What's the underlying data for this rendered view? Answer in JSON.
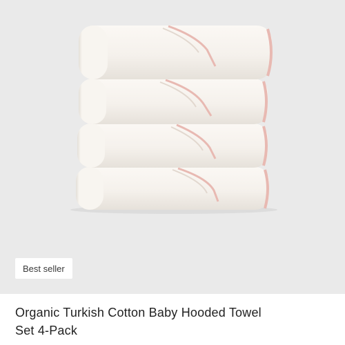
{
  "product": {
    "badge": "Best seller",
    "title_line1": "Organic Turkish Cotton Baby Hooded Towel",
    "title_line2": "Set 4-Pack",
    "image_alt": "Stack of four white towels with pink trim"
  },
  "colors": {
    "image_background": "#eaeaea",
    "towel": "#f7f3ee",
    "trim": "#e8b9b2",
    "badge_background": "#ffffff"
  }
}
